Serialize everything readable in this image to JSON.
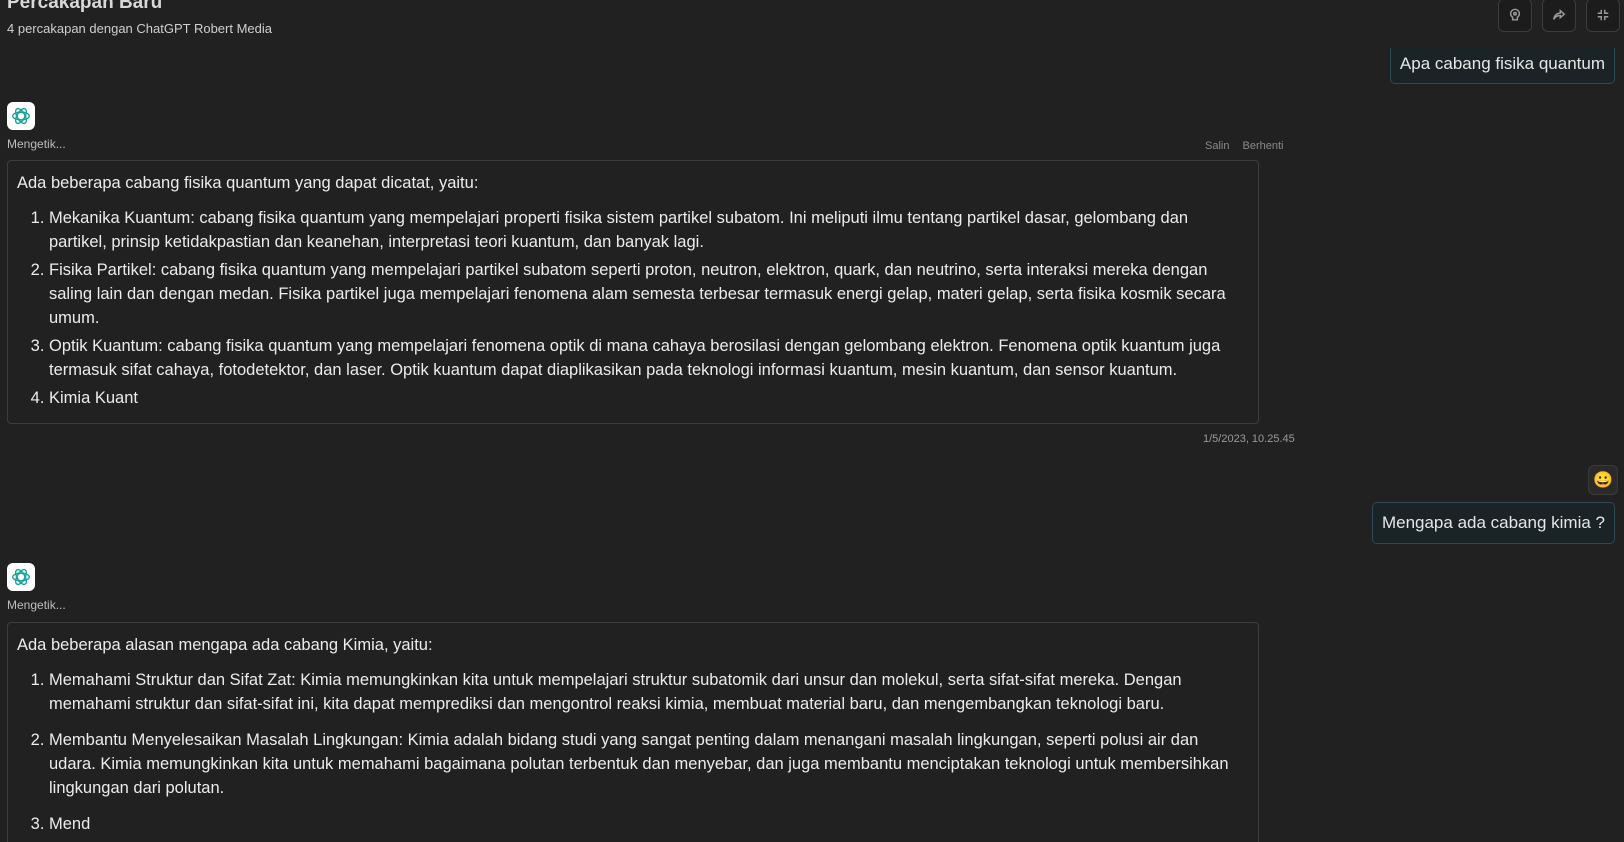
{
  "header": {
    "title": "Percakapan Baru",
    "subtitle": "4 percakapan dengan ChatGPT Robert Media",
    "buttons": [
      "feedback-icon",
      "share-icon",
      "fullscreen-icon"
    ]
  },
  "messages": {
    "user1": "Apa cabang fisika quantum",
    "bot1": {
      "status": "Mengetik...",
      "actions": {
        "copy": "Salin",
        "stop": "Berhenti"
      },
      "intro": "Ada beberapa cabang fisika quantum yang dapat dicatat, yaitu:",
      "items": [
        "Mekanika Kuantum: cabang fisika quantum yang mempelajari properti fisika sistem partikel subatom. Ini meliputi ilmu tentang partikel dasar, gelombang dan partikel, prinsip ketidakpastian dan keanehan, interpretasi teori kuantum, dan banyak lagi.",
        "Fisika Partikel: cabang fisika quantum yang mempelajari partikel subatom seperti proton, neutron, elektron, quark, dan neutrino, serta interaksi mereka dengan saling lain dan dengan medan. Fisika partikel juga mempelajari fenomena alam semesta terbesar termasuk energi gelap, materi gelap, serta fisika kosmik secara umum.",
        "Optik Kuantum: cabang fisika quantum yang mempelajari fenomena optik di mana cahaya berosilasi dengan gelombang elektron. Fenomena optik kuantum juga termasuk sifat cahaya, fotodetektor, dan laser. Optik kuantum dapat diaplikasikan pada teknologi informasi kuantum, mesin kuantum, dan sensor kuantum.",
        "Kimia Kuant"
      ],
      "timestamp": "1/5/2023, 10.25.45"
    },
    "user_avatar": "😀",
    "user2": "Mengapa ada cabang kimia ?",
    "bot2": {
      "status": "Mengetik...",
      "intro": "Ada beberapa alasan mengapa ada cabang Kimia, yaitu:",
      "items": [
        "Memahami Struktur dan Sifat Zat: Kimia memungkinkan kita untuk mempelajari struktur subatomik dari unsur dan molekul, serta sifat-sifat mereka. Dengan memahami struktur dan sifat-sifat ini, kita dapat memprediksi dan mengontrol reaksi kimia, membuat material baru, dan mengembangkan teknologi baru.",
        "Membantu Menyelesaikan Masalah Lingkungan: Kimia adalah bidang studi yang sangat penting dalam menangani masalah lingkungan, seperti polusi air dan udara. Kimia memungkinkan kita untuk memahami bagaimana polutan terbentuk dan menyebar, dan juga membantu menciptakan teknologi untuk membersihkan lingkungan dari polutan.",
        "Mend"
      ]
    }
  }
}
